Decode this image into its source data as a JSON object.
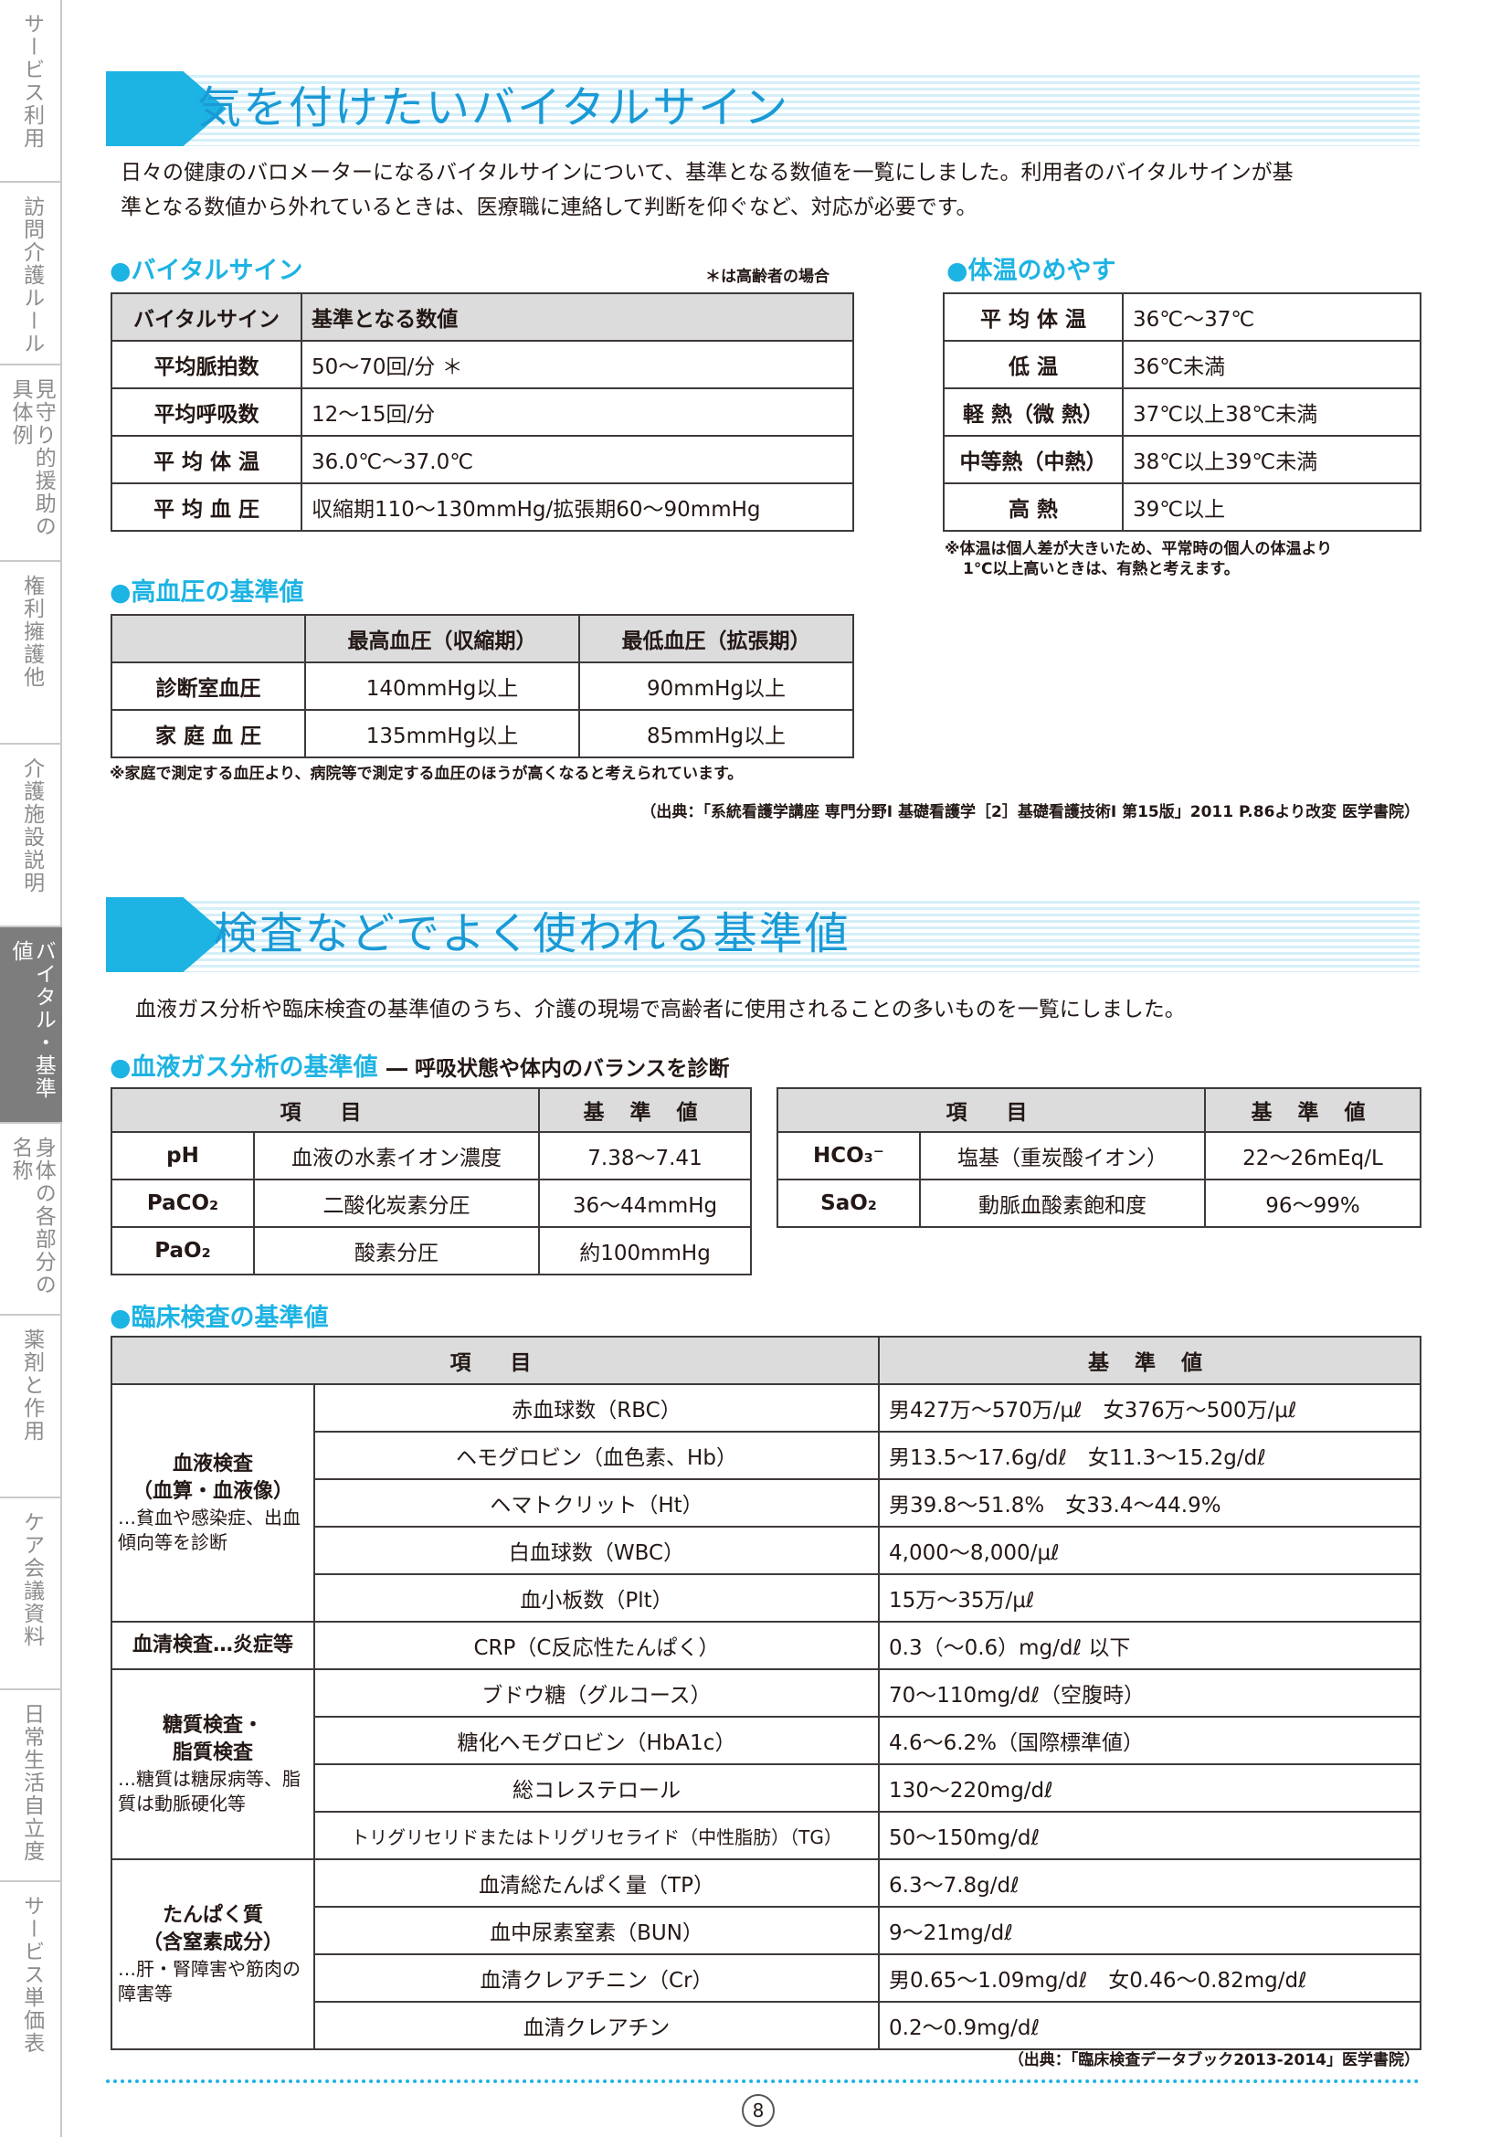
{
  "sidebar": {
    "tabs": [
      {
        "label": "サービス利用"
      },
      {
        "label": "訪問介護ルール"
      },
      {
        "label": "見守り的援助の具体例"
      },
      {
        "label": "権利擁護他"
      },
      {
        "label": "介護施設説明"
      },
      {
        "label": "バイタル・基準値"
      },
      {
        "label": "身体の各部分の名称"
      },
      {
        "label": "薬剤と作用"
      },
      {
        "label": "ケア会議資料"
      },
      {
        "label": "日常生活自立度"
      },
      {
        "label": "サービス単価表"
      }
    ]
  },
  "section1": {
    "title": "気を付けたいバイタルサイン",
    "lead_line1": "日々の健康のバロメーターになるバイタルサインについて、基準となる数値を一覧にしました。利用者のバイタルサインが基",
    "lead_line2": "準となる数値から外れているときは、医療職に連絡して判断を仰ぐなど、対応が必要です。",
    "vital": {
      "heading": "●バイタルサイン",
      "elderly_note": "＊は高齢者の場合",
      "headers": [
        "バイタルサイン",
        "基準となる数値"
      ],
      "rows": [
        [
          "平均脈拍数",
          "50～70回/分 ＊"
        ],
        [
          "平均呼吸数",
          "12～15回/分"
        ],
        [
          "平 均 体 温",
          "36.0℃～37.0℃"
        ],
        [
          "平 均 血 圧",
          "収縮期110～130mmHg/拡張期60～90mmHg"
        ]
      ]
    },
    "temp": {
      "heading": "●体温のめやす",
      "rows": [
        [
          "平 均 体 温",
          "36℃～37℃"
        ],
        [
          "低 温",
          "36℃未満"
        ],
        [
          "軽 熱（微 熱）",
          "37℃以上38℃未満"
        ],
        [
          "中等熱（中熱）",
          "38℃以上39℃未満"
        ],
        [
          "高 熱",
          "39℃以上"
        ]
      ],
      "note1": "※体温は個人差が大きいため、平常時の個人の体温より",
      "note2": "1℃以上高いときは、有熱と考えます。"
    },
    "bp": {
      "heading": "●高血圧の基準値",
      "headers": [
        "",
        "最高血圧（収縮期）",
        "最低血圧（拡張期）"
      ],
      "rows": [
        [
          "診断室血圧",
          "140mmHg以上",
          "90mmHg以上"
        ],
        [
          "家 庭 血 圧",
          "135mmHg以上",
          "85mmHg以上"
        ]
      ],
      "note": "※家庭で測定する血圧より、病院等で測定する血圧のほうが高くなると考えられています。"
    },
    "source": "（出典：「系統看護学講座 専門分野Ⅰ 基礎看護学［2］基礎看護技術Ⅰ 第15版」2011 P.86より改変 医学書院）"
  },
  "section2": {
    "title": "検査などでよく使われる基準値",
    "lead": "血液ガス分析や臨床検査の基準値のうち、介護の現場で高齢者に使用されることの多いものを一覧にしました。",
    "gas": {
      "heading": "●血液ガス分析の基準値",
      "heading_sub": "― 呼吸状態や体内のバランスを診断",
      "headers": [
        "項　目",
        "基 準 値"
      ],
      "left_rows": [
        [
          "pH",
          "血液の水素イオン濃度",
          "7.38～7.41"
        ],
        [
          "PaCO₂",
          "二酸化炭素分圧",
          "36～44mmHg"
        ],
        [
          "PaO₂",
          "酸素分圧",
          "約100mmHg"
        ]
      ],
      "right_rows": [
        [
          "HCO₃⁻",
          "塩基（重炭酸イオン）",
          "22～26mEq/L"
        ],
        [
          "SaO₂",
          "動脈血酸素飽和度",
          "96～99%"
        ]
      ]
    },
    "clinical": {
      "heading": "●臨床検査の基準値",
      "headers": [
        "項　目",
        "基 準 値"
      ],
      "groups": [
        {
          "title1": "血液検査",
          "title2": "（血算・血液像）",
          "desc": "…貧血や感染症、出血傾向等を診断"
        },
        {
          "title1": "血清検査…炎症等",
          "title2": "",
          "desc": ""
        },
        {
          "title1": "糖質検査・",
          "title2": "脂質検査",
          "desc": "…糖質は糖尿病等、脂質は動脈硬化等"
        },
        {
          "title1": "たんぱく質",
          "title2": "（含窒素成分）",
          "desc": "…肝・腎障害や筋肉の障害等"
        }
      ],
      "rows": [
        [
          "赤血球数（RBC）",
          "男427万～570万/μℓ　女376万～500万/μℓ"
        ],
        [
          "ヘモグロビン（血色素、Hb）",
          "男13.5～17.6g/dℓ　女11.3～15.2g/dℓ"
        ],
        [
          "ヘマトクリット（Ht）",
          "男39.8～51.8%　女33.4～44.9%"
        ],
        [
          "白血球数（WBC）",
          "4,000～8,000/μℓ"
        ],
        [
          "血小板数（Plt）",
          "15万～35万/μℓ"
        ],
        [
          "CRP（C反応性たんぱく）",
          "0.3（～0.6）mg/dℓ 以下"
        ],
        [
          "ブドウ糖（グルコース）",
          "70～110mg/dℓ（空腹時）"
        ],
        [
          "糖化ヘモグロビン（HbA1c）",
          "4.6～6.2%（国際標準値）"
        ],
        [
          "総コレステロール",
          "130～220mg/dℓ"
        ],
        [
          "トリグリセリドまたはトリグリセライド（中性脂肪）（TG）",
          "50～150mg/dℓ"
        ],
        [
          "血清総たんぱく量（TP）",
          "6.3～7.8g/dℓ"
        ],
        [
          "血中尿素窒素（BUN）",
          "9～21mg/dℓ"
        ],
        [
          "血清クレアチニン（Cr）",
          "男0.65～1.09mg/dℓ　女0.46～0.82mg/dℓ"
        ],
        [
          "血清クレアチン",
          "0.2～0.9mg/dℓ"
        ]
      ]
    },
    "source": "（出典：「臨床検査データブック2013-2014」医学書院）"
  },
  "page_number": "8"
}
